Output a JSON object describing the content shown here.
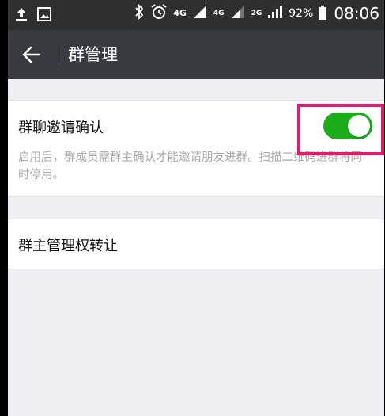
{
  "status_bar": {
    "left_icons": [
      "upload-icon",
      "image-icon"
    ],
    "right_icons": [
      "bluetooth-icon",
      "alarm-icon",
      "signal-icon",
      "signal-icon",
      "battery-icon"
    ],
    "net1": "4G",
    "net2": "4G",
    "net3": "2G",
    "battery_percent": "92%",
    "time": "08:06"
  },
  "header": {
    "back_icon": "back-arrow-icon",
    "title": "群管理"
  },
  "settings": {
    "invite_confirm": {
      "label": "群聊邀请确认",
      "enabled": true,
      "description": "启用后，群成员需群主确认才能邀请朋友进群。扫描二维码进群将同时停用。"
    },
    "transfer": {
      "label": "群主管理权转让"
    }
  },
  "colors": {
    "toggle_on": "#1aad19",
    "highlight_box": "#e8186e",
    "titlebar": "#393a3f"
  }
}
